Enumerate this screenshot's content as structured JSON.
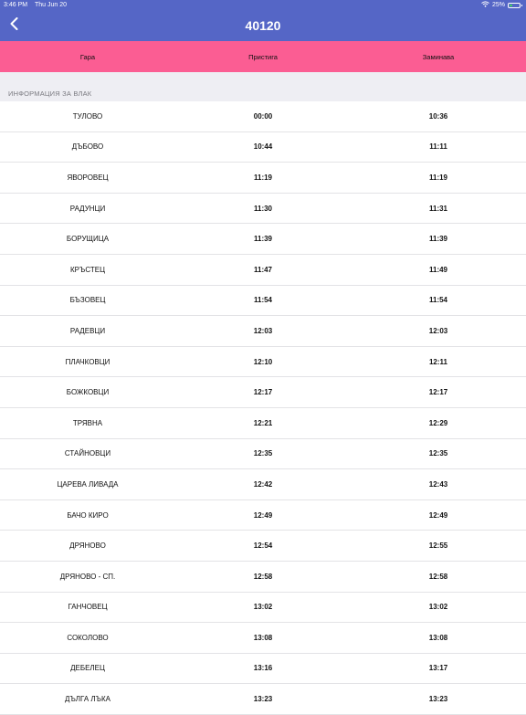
{
  "status_bar": {
    "time": "3:46 PM",
    "date": "Thu Jun 20",
    "battery": "25%",
    "battery_level": 0.25
  },
  "header": {
    "title": "40120"
  },
  "columns": {
    "station": "Гара",
    "arrives": "Пристига",
    "departs": "Заминава"
  },
  "section_label": "ИНФОРМАЦИЯ ЗА ВЛАК",
  "rows": [
    {
      "station": "ТУЛОВО",
      "arrive": "00:00",
      "depart": "10:36"
    },
    {
      "station": "ДЪБОВО",
      "arrive": "10:44",
      "depart": "11:11"
    },
    {
      "station": "ЯВОРОВЕЦ",
      "arrive": "11:19",
      "depart": "11:19"
    },
    {
      "station": "РАДУНЦИ",
      "arrive": "11:30",
      "depart": "11:31"
    },
    {
      "station": "БОРУЩИЦА",
      "arrive": "11:39",
      "depart": "11:39"
    },
    {
      "station": "КРЪСТЕЦ",
      "arrive": "11:47",
      "depart": "11:49"
    },
    {
      "station": "БЪЗОВЕЦ",
      "arrive": "11:54",
      "depart": "11:54"
    },
    {
      "station": "РАДЕВЦИ",
      "arrive": "12:03",
      "depart": "12:03"
    },
    {
      "station": "ПЛАЧКОВЦИ",
      "arrive": "12:10",
      "depart": "12:11"
    },
    {
      "station": "БОЖКОВЦИ",
      "arrive": "12:17",
      "depart": "12:17"
    },
    {
      "station": "ТРЯВНА",
      "arrive": "12:21",
      "depart": "12:29"
    },
    {
      "station": "СТАЙНОВЦИ",
      "arrive": "12:35",
      "depart": "12:35"
    },
    {
      "station": "ЦАРЕВА ЛИВАДА",
      "arrive": "12:42",
      "depart": "12:43"
    },
    {
      "station": "БАЧО КИРО",
      "arrive": "12:49",
      "depart": "12:49"
    },
    {
      "station": "ДРЯНОВО",
      "arrive": "12:54",
      "depart": "12:55"
    },
    {
      "station": "ДРЯНОВО - СП.",
      "arrive": "12:58",
      "depart": "12:58"
    },
    {
      "station": "ГАНЧОВЕЦ",
      "arrive": "13:02",
      "depart": "13:02"
    },
    {
      "station": "СОКОЛОВО",
      "arrive": "13:08",
      "depart": "13:08"
    },
    {
      "station": "ДЕБЕЛЕЦ",
      "arrive": "13:16",
      "depart": "13:17"
    },
    {
      "station": "ДЪЛГА ЛЪКА",
      "arrive": "13:23",
      "depart": "13:23"
    }
  ],
  "colors": {
    "header_bg": "#5566c6",
    "column_header_bg": "#fb5d93",
    "section_bg": "#eeeef3"
  }
}
